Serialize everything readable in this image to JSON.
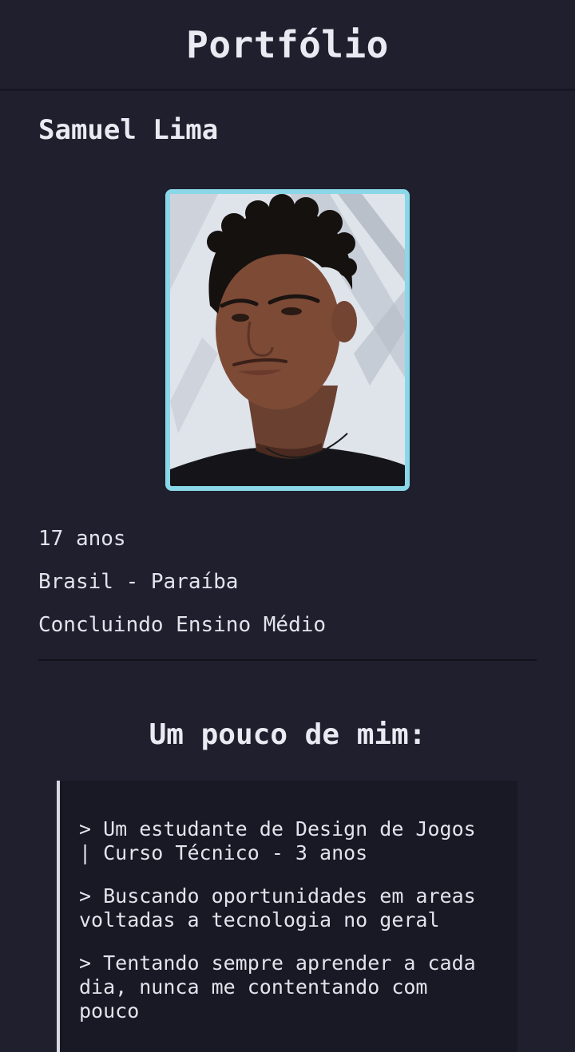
{
  "header": {
    "title": "Portfólio"
  },
  "profile": {
    "name": "Samuel Lima",
    "age": "17 anos",
    "location": "Brasil - Paraíba",
    "education": "Concluindo Ensino Médio",
    "photo_border_color": "#8ad7e8"
  },
  "about": {
    "title": "Um pouco de mim:",
    "items": [
      "> Um estudante de Design de Jogos\n| Curso Técnico - 3 anos",
      "> Buscando oportunidades em areas\nvoltadas a tecnologia no geral",
      "> Tentando sempre aprender a cada\ndia, nunca me contentando com\npouco"
    ]
  },
  "colors": {
    "background": "#1f1f2e",
    "text": "#e6e6ef",
    "accent": "#8ad7e8"
  }
}
